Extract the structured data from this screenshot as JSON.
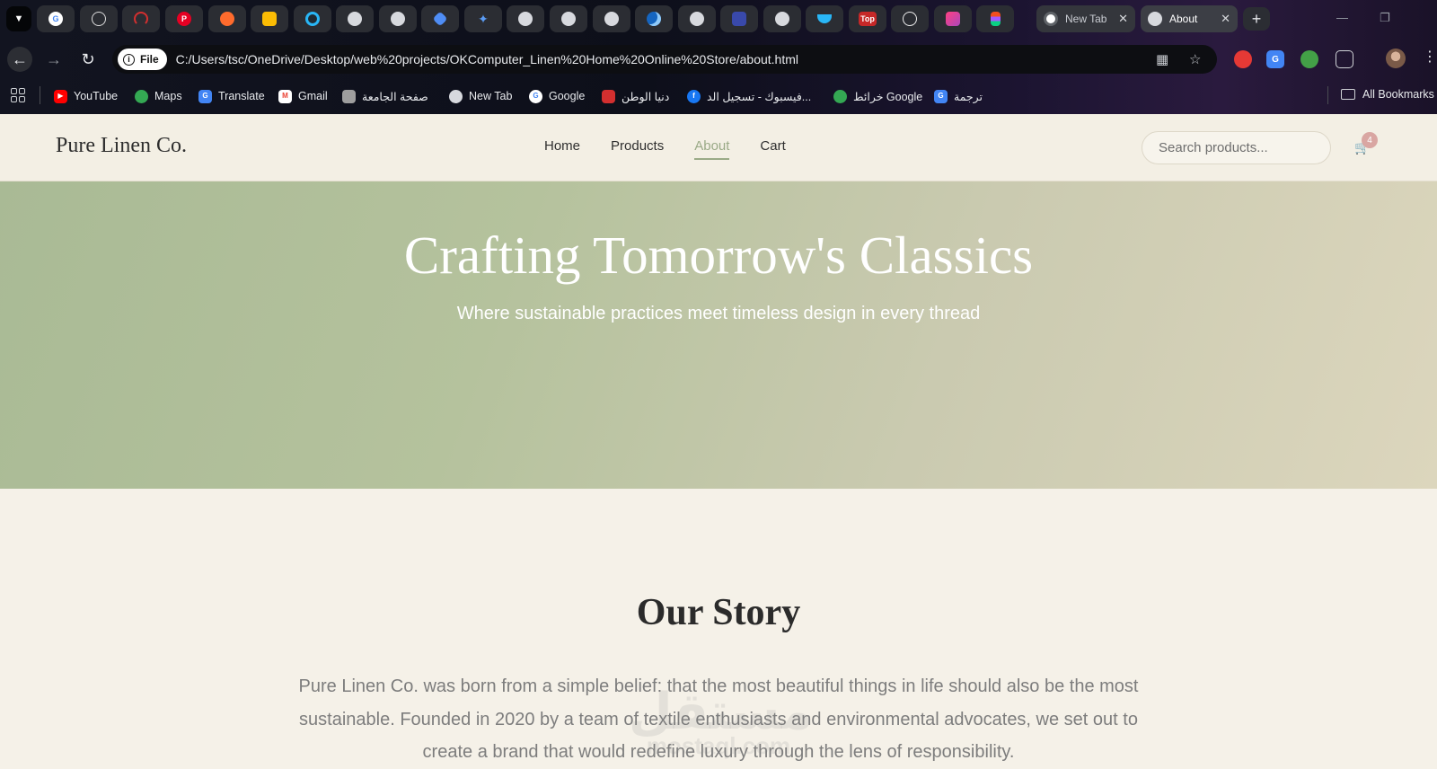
{
  "browser": {
    "tabs": [
      {
        "label": "New Tab"
      },
      {
        "label": "About"
      }
    ],
    "address": {
      "chip": "File",
      "url": "C:/Users/tsc/OneDrive/Desktop/web%20projects/OKComputer_Linen%20Home%20Online%20Store/about.html"
    },
    "bookmarks": [
      {
        "label": "YouTube",
        "icon": "youtube-icon"
      },
      {
        "label": "Maps",
        "icon": "maps-pin-icon"
      },
      {
        "label": "Translate",
        "icon": "translate-icon"
      },
      {
        "label": "Gmail",
        "icon": "gmail-icon"
      },
      {
        "label": "صفحة الجامعة",
        "icon": "university-icon"
      },
      {
        "label": "New Tab",
        "icon": "globe-icon"
      },
      {
        "label": "Google",
        "icon": "google-icon"
      },
      {
        "label": "دنيا الوطن",
        "icon": "news-icon"
      },
      {
        "label": "فيسبوك - تسجيل الد...",
        "icon": "facebook-icon"
      },
      {
        "label": "خرائط Google",
        "icon": "maps-pin-icon"
      },
      {
        "label": "ترجمة",
        "icon": "translate-icon"
      }
    ],
    "all_bookmarks": "All Bookmarks"
  },
  "site": {
    "logo": "Pure Linen Co.",
    "nav": [
      {
        "label": "Home"
      },
      {
        "label": "Products"
      },
      {
        "label": "About"
      },
      {
        "label": "Cart"
      }
    ],
    "active_nav": "About",
    "search_placeholder": "Search products...",
    "cart_count": "4"
  },
  "hero": {
    "title": "Crafting Tomorrow's Classics",
    "subtitle": "Where sustainable practices meet timeless design in every thread"
  },
  "story": {
    "heading": "Our Story",
    "body": "Pure Linen Co. was born from a simple belief: that the most beautiful things in life should also be the most sustainable. Founded in 2020 by a team of textile enthusiasts and environmental advocates, we set out to create a brand that would redefine luxury through the lens of responsibility."
  },
  "watermark": {
    "arabic": "مستقل",
    "latin": "mostaql.com"
  },
  "colors": {
    "accent": "#9aaa87",
    "hero_start": "#a9ba95",
    "hero_end": "#dcd6bd",
    "badge": "#d9a6a2",
    "page_bg": "#f5f1e8"
  }
}
